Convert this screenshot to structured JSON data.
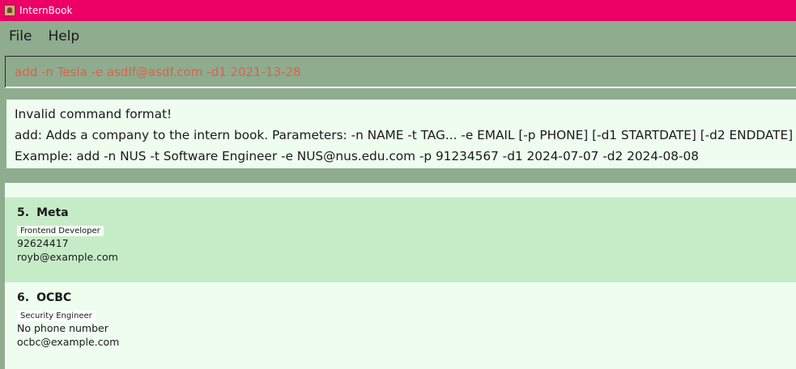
{
  "window": {
    "title": "InternBook"
  },
  "menu": {
    "file_label": "File",
    "help_label": "Help"
  },
  "command": {
    "value": "add -n Tesla -e asdlf@asdf.com -d1 2021-13-28"
  },
  "result": {
    "lines": [
      "Invalid command format!",
      "add: Adds a company to the intern book. Parameters: -n NAME -t TAG... -e EMAIL [-p PHONE] [-d1 STARTDATE] [-d2 ENDDATE]",
      "Example: add -n NUS -t Software Engineer -e NUS@nus.edu.com -p 91234567 -d1 2024-07-07 -d2 2024-08-08"
    ]
  },
  "companies": [
    {
      "index": "5.",
      "name": "Meta",
      "tag": "Frontend Developer",
      "phone": "92624417",
      "email": "royb@example.com"
    },
    {
      "index": "6.",
      "name": "OCBC",
      "tag": "Security Engineer",
      "phone": "No phone number",
      "email": "ocbc@example.com"
    }
  ],
  "colors": {
    "titlebar": "#ec0066",
    "background": "#8fac8f",
    "panel": "#eefdef",
    "card_alt": "#c6ecc7",
    "command_text": "#d9634b"
  }
}
